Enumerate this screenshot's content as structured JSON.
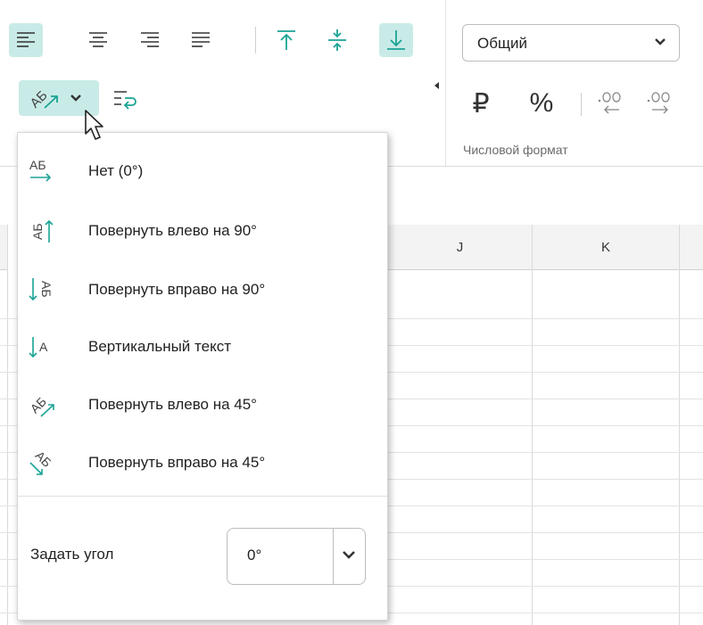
{
  "toolbar": {
    "align_left_icon": "align-left-icon",
    "align_center_icon": "align-center-icon",
    "align_right_icon": "align-right-icon",
    "align_justify_icon": "align-justify-icon",
    "valign_top_icon": "valign-top-icon",
    "valign_middle_icon": "valign-middle-icon",
    "valign_bottom_icon": "valign-bottom-icon",
    "text_orientation_icon": "text-orientation-icon",
    "wrap_text_icon": "wrap-text-icon"
  },
  "number_format": {
    "selected": "Общий",
    "currency_symbol": "₽",
    "percent_symbol": "%",
    "group_label": "Числовой формат"
  },
  "columns": [
    "J",
    "K"
  ],
  "orientation_menu": {
    "items": [
      {
        "label": "Нет (0°)",
        "icon": "text-horizontal-icon"
      },
      {
        "label": "Повернуть влево на 90°",
        "icon": "rotate-up-icon"
      },
      {
        "label": "Повернуть вправо на 90°",
        "icon": "rotate-down-icon"
      },
      {
        "label": "Вертикальный текст",
        "icon": "vertical-text-icon"
      },
      {
        "label": "Повернуть влево на 45°",
        "icon": "angle-counterclockwise-icon"
      },
      {
        "label": "Повернуть вправо на 45°",
        "icon": "angle-clockwise-icon"
      }
    ],
    "angle_label": "Задать угол",
    "angle_value": "0°"
  },
  "colors": {
    "accent": "#1aa395",
    "active_bg": "#c9ebe7"
  }
}
